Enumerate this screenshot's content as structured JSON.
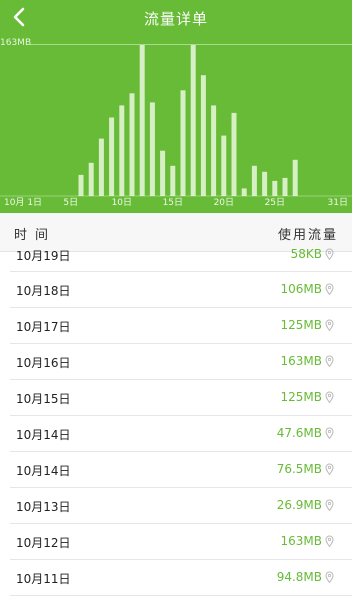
{
  "header": {
    "title": "流量详单",
    "max_label": "163MB"
  },
  "chart_data": {
    "type": "bar",
    "x": [
      1,
      2,
      3,
      4,
      5,
      6,
      7,
      8,
      9,
      10,
      11,
      12,
      13,
      14,
      15,
      16,
      17,
      18,
      19,
      20,
      21,
      22,
      23,
      24,
      25,
      26,
      27,
      28,
      29,
      30,
      31
    ],
    "values": [
      null,
      null,
      null,
      null,
      null,
      null,
      null,
      null,
      null,
      null,
      null,
      null,
      null,
      null,
      null,
      null,
      null,
      null,
      null,
      null,
      null,
      null,
      null,
      null,
      null,
      null,
      null,
      null,
      null,
      null,
      null
    ],
    "heights_rel": [
      0,
      0,
      0,
      0,
      0,
      0.14,
      0.22,
      0.38,
      0.52,
      0.6,
      0.68,
      1.0,
      0.62,
      0.3,
      0.2,
      0.7,
      1.0,
      0.8,
      0.6,
      0.4,
      0.55,
      0.05,
      0.2,
      0.16,
      0.1,
      0.12,
      0.24,
      0,
      0,
      0,
      0
    ],
    "x_ticks": [
      "10月 1日",
      "5日",
      "10日",
      "15日",
      "20日",
      "25日",
      "31日"
    ],
    "ylim": [
      0,
      163
    ],
    "ylabel_max": "163MB",
    "bar_color": "#d7efc4"
  },
  "table": {
    "col_time": "时间",
    "col_usage": "使用流量",
    "rows": [
      {
        "date": "10月19日",
        "value": "58KB"
      },
      {
        "date": "10月18日",
        "value": "106MB"
      },
      {
        "date": "10月17日",
        "value": "125MB"
      },
      {
        "date": "10月16日",
        "value": "163MB"
      },
      {
        "date": "10月15日",
        "value": "125MB"
      },
      {
        "date": "10月14日",
        "value": "47.6MB"
      },
      {
        "date": "10月14日",
        "value": "76.5MB"
      },
      {
        "date": "10月13日",
        "value": "26.9MB"
      },
      {
        "date": "10月12日",
        "value": "163MB"
      },
      {
        "date": "10月11日",
        "value": "94.8MB"
      }
    ]
  },
  "colors": {
    "accent": "#67bb36",
    "value_text": "#67bb36"
  },
  "icons": {
    "back": "chevron-left-icon",
    "pin": "location-pin-icon"
  }
}
